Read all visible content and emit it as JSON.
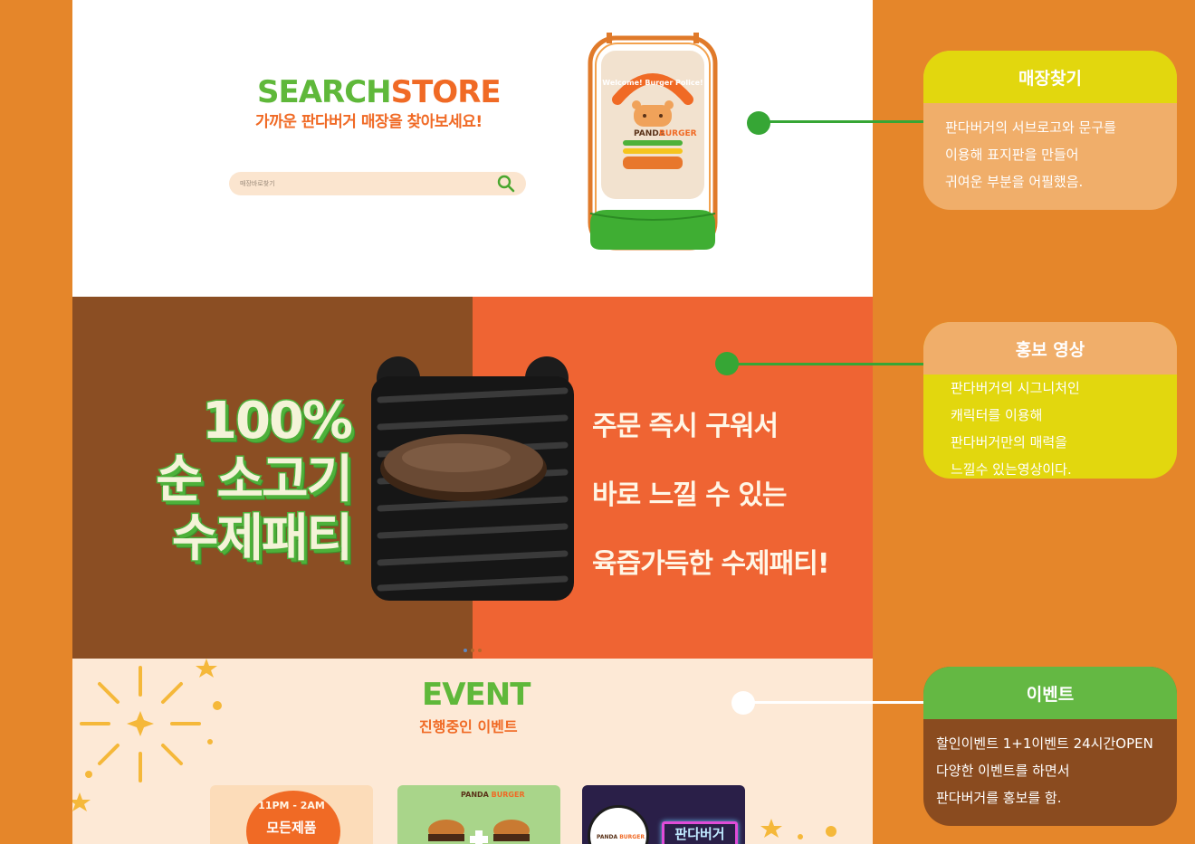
{
  "search_section": {
    "title_part1": "SEARCH",
    "title_part2": "STORE",
    "subtitle": "가까운 판다버거 매장을 찾아보세요!",
    "search_placeholder": "매장바로찾기",
    "sign_arc_text": "Welcome! Burger Police!",
    "sign_brand_1": "PANDA",
    "sign_brand_2": "BURGER"
  },
  "promo_section": {
    "headline": [
      "100%",
      "순 소고기",
      "수제패티"
    ],
    "lines": [
      "주문 즉시 구워서",
      "바로 느낄 수 있는",
      "육즙가득한 수제패티!"
    ],
    "slide_count": 3,
    "active_slide": 0
  },
  "event_section": {
    "title": "EVENT",
    "subtitle": "진행중인 이벤트",
    "cards": [
      {
        "top": "11PM - 2AM",
        "main": "모든제품"
      },
      {
        "brand_1": "PANDA",
        "brand_2": "BURGER"
      },
      {
        "brand_1": "PANDA",
        "brand_2": "BURGER",
        "neon": "판다버거"
      }
    ]
  },
  "annotations": [
    {
      "title": "매장찾기",
      "lines": [
        "판다버거의 서브로고와 문구를",
        "이용해 표지판을 만들어",
        "귀여운 부분을 어필했음."
      ]
    },
    {
      "title": "홍보 영상",
      "lines": [
        "판다버거의 시그니처인",
        "캐릭터를 이용해",
        "판다버거만의 매력을",
        "느낄수 있는영상이다."
      ]
    },
    {
      "title": "이벤트",
      "lines": [
        "할인이벤트 1+1이벤트 24시간OPEN",
        "다양한 이벤트를 하면서",
        "판다버거를 홍보를 함."
      ]
    }
  ],
  "colors": {
    "background_orange": "#e5862a",
    "brand_green": "#5fb83a",
    "brand_orange": "#f06a25",
    "promo_brown": "#8b4e23",
    "promo_orange": "#ef6433",
    "event_cream": "#fde9d6",
    "callout_yellow": "#e2d70e",
    "callout_peach": "#f0ae6a",
    "callout_green": "#64b843",
    "callout_brown": "#8a4b1f"
  }
}
